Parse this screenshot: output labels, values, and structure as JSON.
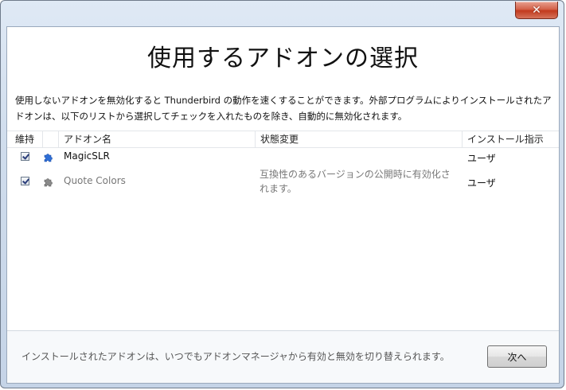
{
  "window": {
    "close_glyph": "✕"
  },
  "page": {
    "title": "使用するアドオンの選択",
    "description": "使用しないアドオンを無効化すると Thunderbird の動作を速くすることができます。外部プログラムによりインストールされたアドオンは、以下のリストから選択してチェックを入れたものを除き、自動的に無効化されます。"
  },
  "table": {
    "headers": {
      "keep": "維持",
      "name": "アドオン名",
      "state": "状態変更",
      "source": "インストール指示"
    },
    "rows": [
      {
        "checked": true,
        "icon": "puzzle-icon",
        "icon_color": "#2f6fd6",
        "name": "MagicSLR",
        "state": "",
        "source": "ユーザ"
      },
      {
        "checked": true,
        "icon": "puzzle-icon",
        "icon_color": "#7a7a7a",
        "name": "Quote Colors",
        "state": "互換性のあるバージョンの公開時に有効化されます。",
        "source": "ユーザ"
      }
    ]
  },
  "footer": {
    "text": "インストールされたアドオンは、いつでもアドオンマネージャから有効と無効を切り替えられます。",
    "next_label": "次へ"
  }
}
